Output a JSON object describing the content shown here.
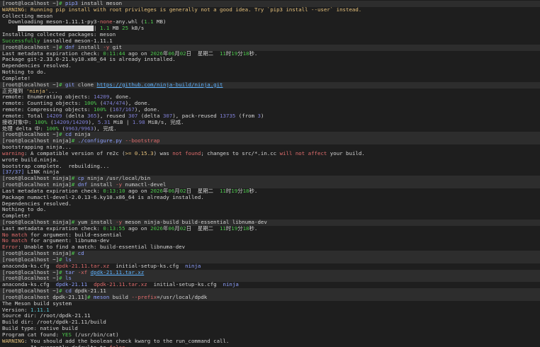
{
  "palette": {
    "background": "#1e1e1e",
    "prompt_bg": "#2d2d2d",
    "green": "#4ec94e",
    "red": "#e06c6c",
    "yellow": "#e5c07b",
    "blue": "#8ea0ff"
  },
  "lines": [
    {
      "p": true,
      "s": [
        [
          "w",
          "[root@localhost ~]"
        ],
        [
          "g",
          "# "
        ],
        [
          "b",
          "pip3"
        ],
        [
          "w",
          " install meson"
        ]
      ]
    },
    {
      "s": [
        [
          "y",
          "WARNING: Running pip install with root privileges is generally not a good idea. Try `pip3 install --user` instead."
        ]
      ]
    },
    {
      "s": [
        [
          "w",
          "Collecting meson"
        ]
      ]
    },
    {
      "s": [
        [
          "w",
          "  Downloading meson-1.11.1-py3-"
        ],
        [
          "r",
          "none"
        ],
        [
          "w",
          "-any.whl ("
        ],
        [
          "g",
          "1.1"
        ],
        [
          "w",
          " MB)"
        ]
      ]
    },
    {
      "s": [
        [
          "w",
          "     "
        ],
        [
          "bar",
          "████████████████████████"
        ],
        [
          "w",
          "| "
        ],
        [
          "g",
          "1.1"
        ],
        [
          "w",
          " MB "
        ],
        [
          "g",
          "25"
        ],
        [
          "w",
          " kB/s"
        ]
      ]
    },
    {
      "s": [
        [
          "w",
          "Installing collected packages: meson"
        ]
      ]
    },
    {
      "s": [
        [
          "g",
          "Successfully"
        ],
        [
          "w",
          " installed meson-1.11.1"
        ]
      ]
    },
    {
      "p": true,
      "s": [
        [
          "w",
          "[root@localhost ~]"
        ],
        [
          "g",
          "# "
        ],
        [
          "b",
          "dnf"
        ],
        [
          "w",
          " install "
        ],
        [
          "r",
          "-y"
        ],
        [
          "w",
          " git"
        ]
      ]
    },
    {
      "s": [
        [
          "w",
          "Last metadata expiration check: "
        ],
        [
          "g",
          "0:11:44"
        ],
        [
          "w",
          " ago on "
        ],
        [
          "g",
          "2026"
        ],
        [
          "w",
          "年"
        ],
        [
          "g",
          "06"
        ],
        [
          "w",
          "月"
        ],
        [
          "g",
          "02"
        ],
        [
          "w",
          "日  星期二  "
        ],
        [
          "g",
          "11"
        ],
        [
          "w",
          "时"
        ],
        [
          "g",
          "19"
        ],
        [
          "w",
          "分"
        ],
        [
          "g",
          "18"
        ],
        [
          "w",
          "秒."
        ]
      ]
    },
    {
      "s": [
        [
          "w",
          "Package git-2.33.0-21.ky10.x86_64 is already installed."
        ]
      ]
    },
    {
      "s": [
        [
          "w",
          "Dependencies resolved."
        ]
      ]
    },
    {
      "s": [
        [
          "w",
          "Nothing to do."
        ]
      ]
    },
    {
      "s": [
        [
          "w",
          "Complete!"
        ]
      ]
    },
    {
      "p": true,
      "s": [
        [
          "w",
          "[root@localhost ~]"
        ],
        [
          "g",
          "# "
        ],
        [
          "b",
          "git"
        ],
        [
          "w",
          " clone "
        ],
        [
          "u",
          "https://github.com/ninja-build/ninja.git"
        ]
      ]
    },
    {
      "s": [
        [
          "w",
          "正克隆到 "
        ],
        [
          "y",
          "'ninja'"
        ],
        [
          "w",
          "..."
        ]
      ]
    },
    {
      "s": [
        [
          "w",
          "remote: Enumerating objects: "
        ],
        [
          "p",
          "14209"
        ],
        [
          "w",
          ", done."
        ]
      ]
    },
    {
      "s": [
        [
          "w",
          "remote: Counting objects: "
        ],
        [
          "g",
          "100%"
        ],
        [
          "w",
          " ("
        ],
        [
          "p",
          "474/474"
        ],
        [
          "w",
          "), done."
        ]
      ]
    },
    {
      "s": [
        [
          "w",
          "remote: Compressing objects: "
        ],
        [
          "g",
          "100%"
        ],
        [
          "w",
          " ("
        ],
        [
          "p",
          "167/167"
        ],
        [
          "w",
          "), done."
        ]
      ]
    },
    {
      "s": [
        [
          "w",
          "remote: Total "
        ],
        [
          "p",
          "14209"
        ],
        [
          "w",
          " (delta "
        ],
        [
          "p",
          "365"
        ],
        [
          "w",
          "), reused "
        ],
        [
          "p",
          "307"
        ],
        [
          "w",
          " (delta "
        ],
        [
          "p",
          "307"
        ],
        [
          "w",
          "), pack-reused "
        ],
        [
          "p",
          "13735"
        ],
        [
          "w",
          " (from "
        ],
        [
          "p",
          "3"
        ],
        [
          "w",
          ")"
        ]
      ]
    },
    {
      "s": [
        [
          "w",
          "接收对象中: "
        ],
        [
          "g",
          "100%"
        ],
        [
          "w",
          " ("
        ],
        [
          "p",
          "14209/14209"
        ],
        [
          "w",
          "), "
        ],
        [
          "p",
          "5.31"
        ],
        [
          "w",
          " MiB | "
        ],
        [
          "p",
          "1.98"
        ],
        [
          "w",
          " MiB/s, 完成."
        ]
      ]
    },
    {
      "s": [
        [
          "w",
          "处理 delta 中: "
        ],
        [
          "g",
          "100%"
        ],
        [
          "w",
          " ("
        ],
        [
          "p",
          "9963/9963"
        ],
        [
          "w",
          "), 完成."
        ]
      ]
    },
    {
      "p": true,
      "s": [
        [
          "w",
          "[root@localhost ~]"
        ],
        [
          "g",
          "# "
        ],
        [
          "b",
          "cd"
        ],
        [
          "w",
          " ninja"
        ]
      ]
    },
    {
      "p": true,
      "s": [
        [
          "w",
          "[root@localhost ninja]"
        ],
        [
          "g",
          "# "
        ],
        [
          "b",
          "./configure.py"
        ],
        [
          "w",
          " "
        ],
        [
          "r",
          "--bootstrap"
        ]
      ]
    },
    {
      "s": [
        [
          "w",
          "bootstrapping ninja..."
        ]
      ]
    },
    {
      "s": [
        [
          "r",
          "warning"
        ],
        [
          "w",
          ": A compatible version of re2c ("
        ],
        [
          "y",
          ">= 0.15.3"
        ],
        [
          "w",
          ") was "
        ],
        [
          "r",
          "not found"
        ],
        [
          "w",
          "; changes to src/*.in.cc "
        ],
        [
          "r",
          "will not affect"
        ],
        [
          "w",
          " your build."
        ]
      ]
    },
    {
      "s": [
        [
          "w",
          "wrote build.ninja."
        ]
      ]
    },
    {
      "s": [
        [
          "w",
          "bootstrap complete.  rebuilding..."
        ]
      ]
    },
    {
      "s": [
        [
          "b",
          "[37/37]"
        ],
        [
          "w",
          " LINK ninja"
        ]
      ]
    },
    {
      "p": true,
      "s": [
        [
          "w",
          "[root@localhost ninja]"
        ],
        [
          "g",
          "# "
        ],
        [
          "b",
          "cp"
        ],
        [
          "w",
          " ninja /usr/local/bin"
        ]
      ]
    },
    {
      "p": true,
      "s": [
        [
          "w",
          "[root@localhost ninja]"
        ],
        [
          "g",
          "# "
        ],
        [
          "b",
          "dnf"
        ],
        [
          "w",
          " install "
        ],
        [
          "r",
          "-y"
        ],
        [
          "w",
          " numactl-devel"
        ]
      ]
    },
    {
      "s": [
        [
          "w",
          "Last metadata expiration check: "
        ],
        [
          "g",
          "0:13:10"
        ],
        [
          "w",
          " ago on "
        ],
        [
          "g",
          "2026"
        ],
        [
          "w",
          "年"
        ],
        [
          "g",
          "06"
        ],
        [
          "w",
          "月"
        ],
        [
          "g",
          "02"
        ],
        [
          "w",
          "日  星期二  "
        ],
        [
          "g",
          "11"
        ],
        [
          "w",
          "时"
        ],
        [
          "g",
          "19"
        ],
        [
          "w",
          "分"
        ],
        [
          "g",
          "18"
        ],
        [
          "w",
          "秒."
        ]
      ]
    },
    {
      "s": [
        [
          "w",
          "Package numactl-devel-2.0.13-6.ky10.x86_64 is already installed."
        ]
      ]
    },
    {
      "s": [
        [
          "w",
          "Dependencies resolved."
        ]
      ]
    },
    {
      "s": [
        [
          "w",
          "Nothing to do."
        ]
      ]
    },
    {
      "s": [
        [
          "w",
          "Complete!"
        ]
      ]
    },
    {
      "p": true,
      "s": [
        [
          "w",
          "[root@localhost ninja]"
        ],
        [
          "g",
          "# "
        ],
        [
          "w",
          "yum install "
        ],
        [
          "r",
          "-y"
        ],
        [
          "w",
          " meson ninja-build build-essential libnuma-dev"
        ]
      ]
    },
    {
      "s": [
        [
          "w",
          "Last metadata expiration check: "
        ],
        [
          "g",
          "0:13:55"
        ],
        [
          "w",
          " ago on "
        ],
        [
          "g",
          "2026"
        ],
        [
          "w",
          "年"
        ],
        [
          "g",
          "06"
        ],
        [
          "w",
          "月"
        ],
        [
          "g",
          "02"
        ],
        [
          "w",
          "日  星期二  "
        ],
        [
          "g",
          "11"
        ],
        [
          "w",
          "时"
        ],
        [
          "g",
          "19"
        ],
        [
          "w",
          "分"
        ],
        [
          "g",
          "18"
        ],
        [
          "w",
          "秒."
        ]
      ]
    },
    {
      "s": [
        [
          "r",
          "No match"
        ],
        [
          "w",
          " for argument: build-essential"
        ]
      ]
    },
    {
      "s": [
        [
          "r",
          "No match"
        ],
        [
          "w",
          " for argument: libnuma-dev"
        ]
      ]
    },
    {
      "s": [
        [
          "r",
          "Error"
        ],
        [
          "w",
          ": Unable to find a match: build-essential libnuma-dev"
        ]
      ]
    },
    {
      "p": true,
      "s": [
        [
          "w",
          "[root@localhost ninja]"
        ],
        [
          "g",
          "# "
        ],
        [
          "b",
          "cd"
        ]
      ]
    },
    {
      "p": true,
      "s": [
        [
          "w",
          "[root@localhost ~]"
        ],
        [
          "g",
          "# "
        ],
        [
          "b",
          "ls"
        ]
      ]
    },
    {
      "s": [
        [
          "w",
          "anaconda-ks.cfg  "
        ],
        [
          "r",
          "dpdk-21.11.tar.xz"
        ],
        [
          "w",
          "  initial-setup-ks.cfg  "
        ],
        [
          "b",
          "ninja"
        ]
      ]
    },
    {
      "p": true,
      "s": [
        [
          "w",
          "[root@localhost ~]"
        ],
        [
          "g",
          "# "
        ],
        [
          "b",
          "tar"
        ],
        [
          "w",
          " "
        ],
        [
          "r",
          "-xf"
        ],
        [
          "w",
          " "
        ],
        [
          "u",
          "dpdk-21.11.tar.xz"
        ]
      ]
    },
    {
      "p": true,
      "s": [
        [
          "w",
          "[root@localhost ~]"
        ],
        [
          "g",
          "# "
        ],
        [
          "b",
          "ls"
        ]
      ]
    },
    {
      "s": [
        [
          "w",
          "anaconda-ks.cfg  "
        ],
        [
          "b",
          "dpdk-21.11"
        ],
        [
          "w",
          "  "
        ],
        [
          "r",
          "dpdk-21.11.tar.xz"
        ],
        [
          "w",
          "  initial-setup-ks.cfg  "
        ],
        [
          "b",
          "ninja"
        ]
      ]
    },
    {
      "p": true,
      "s": [
        [
          "w",
          "[root@localhost ~]"
        ],
        [
          "g",
          "# "
        ],
        [
          "b",
          "cd"
        ],
        [
          "w",
          " dpdk-21.11"
        ]
      ]
    },
    {
      "p": true,
      "s": [
        [
          "w",
          "[root@localhost dpdk-21.11]"
        ],
        [
          "g",
          "# "
        ],
        [
          "b",
          "meson"
        ],
        [
          "w",
          " build "
        ],
        [
          "r",
          "--prefix"
        ],
        [
          "w",
          "=/usr/local/dpdk"
        ]
      ]
    },
    {
      "s": [
        [
          "w",
          "The Meson build system"
        ]
      ]
    },
    {
      "s": [
        [
          "w",
          "Version: "
        ],
        [
          "c",
          "1.11.1"
        ]
      ]
    },
    {
      "s": [
        [
          "w",
          "Source dir: /root/dpdk-21.11"
        ]
      ]
    },
    {
      "s": [
        [
          "w",
          "Build dir: /root/dpdk-21.11/build"
        ]
      ]
    },
    {
      "s": [
        [
          "w",
          "Build type: native build"
        ]
      ]
    },
    {
      "s": [
        [
          "w",
          "Program cat found: "
        ],
        [
          "g",
          "YES"
        ],
        [
          "w",
          " (/usr/bin/cat)"
        ]
      ]
    },
    {
      "s": [
        [
          "y",
          "WARNING"
        ],
        [
          "w",
          ": You should add the boolean check kwarg to the run_command call."
        ]
      ]
    },
    {
      "s": [
        [
          "w",
          "         It currently defaults to "
        ],
        [
          "r",
          "false"
        ],
        [
          "w",
          ","
        ]
      ]
    }
  ]
}
